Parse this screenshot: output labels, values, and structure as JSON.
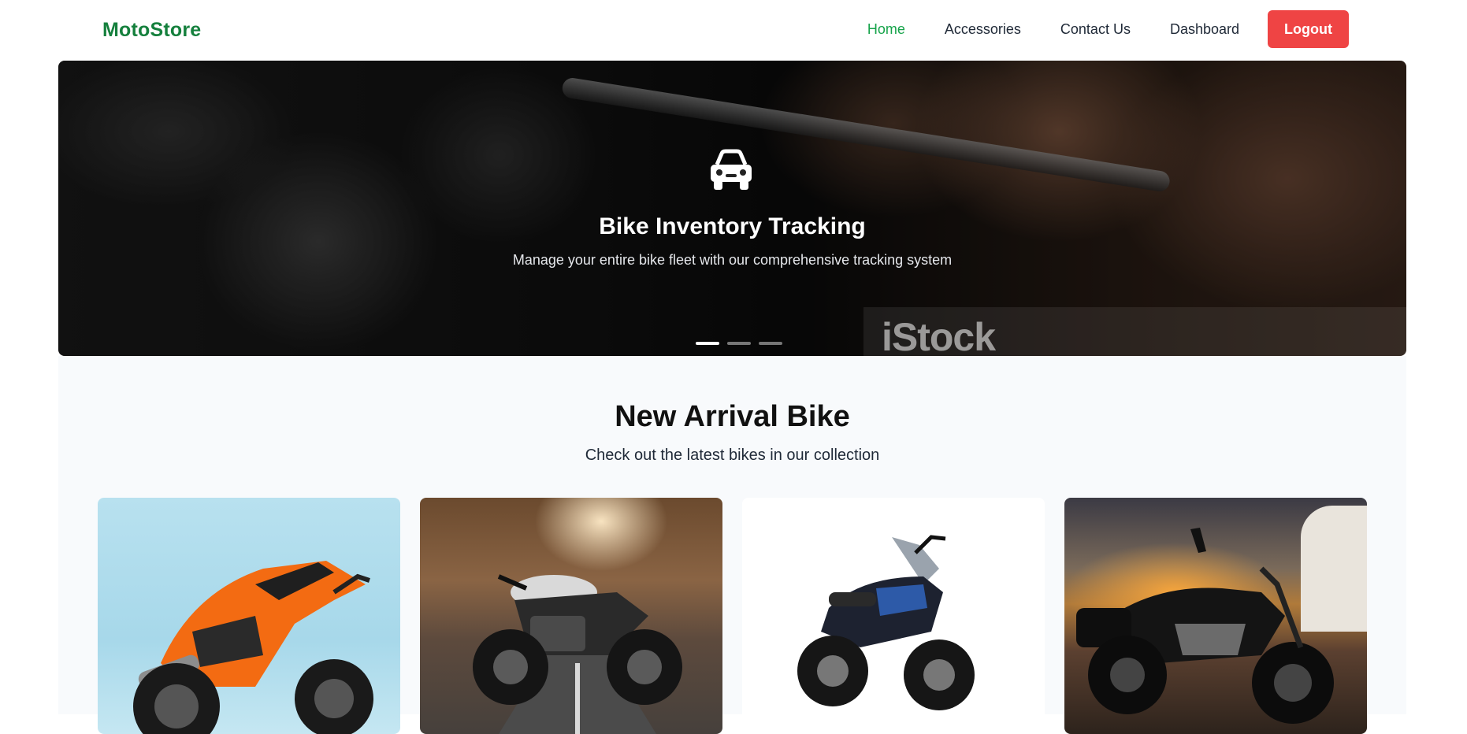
{
  "brand": {
    "name": "MotoStore",
    "color": "#15803d"
  },
  "nav": {
    "links": [
      {
        "label": "Home",
        "active": true
      },
      {
        "label": "Accessories",
        "active": false
      },
      {
        "label": "Contact Us",
        "active": false
      },
      {
        "label": "Dashboard",
        "active": false
      }
    ],
    "logout_label": "Logout",
    "active_color": "#16a34a",
    "logout_color": "#ef4444"
  },
  "hero": {
    "icon": "car-icon",
    "title": "Bike Inventory Tracking",
    "subtitle": "Manage your entire bike fleet with our comprehensive tracking system",
    "watermark": "iStock",
    "slides": 3,
    "active_slide": 1
  },
  "arrivals": {
    "title": "New Arrival Bike",
    "subtitle": "Check out the latest bikes in our collection",
    "cards": [
      {
        "image": "orange-sport-bike"
      },
      {
        "image": "cafe-racer-on-road"
      },
      {
        "image": "black-street-bike"
      },
      {
        "image": "cruiser-at-sunset"
      }
    ]
  }
}
